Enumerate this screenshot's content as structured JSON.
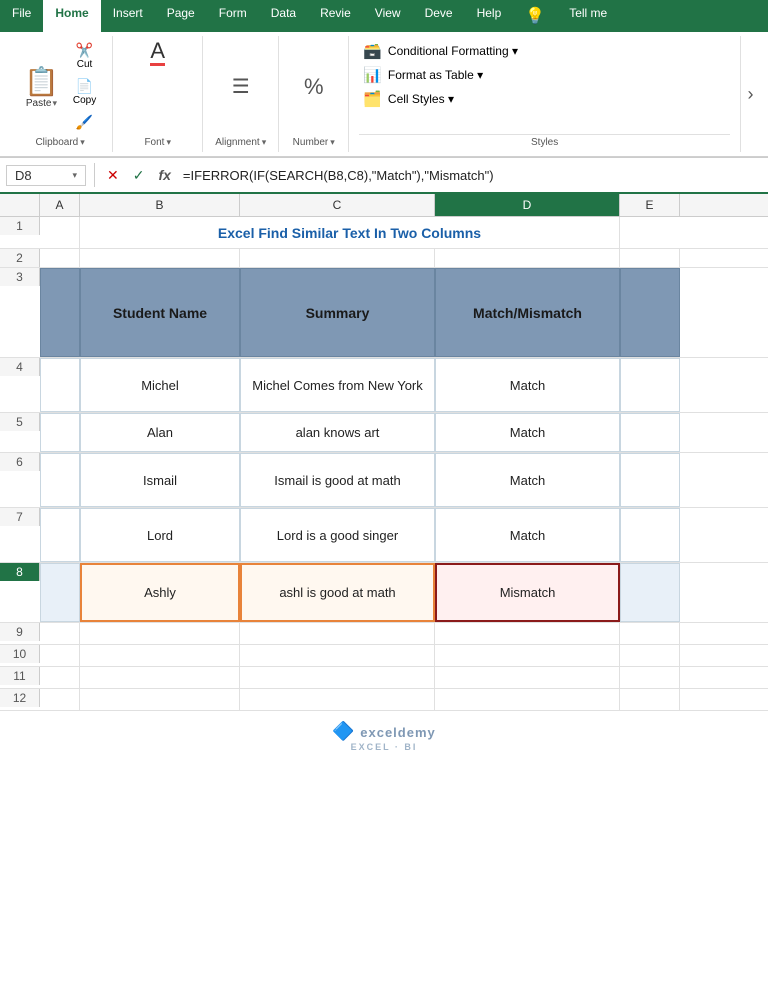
{
  "ribbon": {
    "tabs": [
      {
        "label": "File",
        "active": false
      },
      {
        "label": "Home",
        "active": true
      },
      {
        "label": "Insert",
        "active": false
      },
      {
        "label": "Page",
        "active": false
      },
      {
        "label": "Form",
        "active": false
      },
      {
        "label": "Data",
        "active": false
      },
      {
        "label": "Revie",
        "active": false
      },
      {
        "label": "View",
        "active": false
      },
      {
        "label": "Deve",
        "active": false
      },
      {
        "label": "Help",
        "active": false
      }
    ],
    "tell_me": "Tell me",
    "groups": {
      "clipboard": "Clipboard",
      "font": "Font",
      "alignment": "Alignment",
      "number": "Number",
      "styles": "Styles"
    },
    "styles_items": [
      "Conditional Formatting ▾",
      "Format as Table ▾",
      "Cell Styles ▾"
    ]
  },
  "formula_bar": {
    "cell_ref": "D8",
    "formula": "=IFERROR(IF(SEARCH(B8,C8),\"Match\"),\"Mismatch\")"
  },
  "columns": {
    "headers": [
      "A",
      "B",
      "C",
      "D",
      "E"
    ],
    "active": "D"
  },
  "title": "Excel Find Similar Text In Two Columns",
  "table": {
    "headers": [
      "Student Name",
      "Summary",
      "Match/Mismatch"
    ],
    "rows": [
      {
        "row": 4,
        "name": "Michel",
        "summary": "Michel Comes from New York",
        "result": "Match"
      },
      {
        "row": 5,
        "name": "Alan",
        "summary": "alan knows art",
        "result": "Match"
      },
      {
        "row": 6,
        "name": "Ismail",
        "summary": "Ismail is good at math",
        "result": "Match"
      },
      {
        "row": 7,
        "name": "Lord",
        "summary": "Lord is a good singer",
        "result": "Match"
      },
      {
        "row": 8,
        "name": "Ashly",
        "summary": "ashl is good at math",
        "result": "Mismatch",
        "highlight_b": true,
        "highlight_d": true
      }
    ]
  },
  "watermark": {
    "line1": "exceldemy",
    "line2": "EXCEL · BI"
  },
  "empty_rows": [
    9,
    10,
    11,
    12
  ]
}
